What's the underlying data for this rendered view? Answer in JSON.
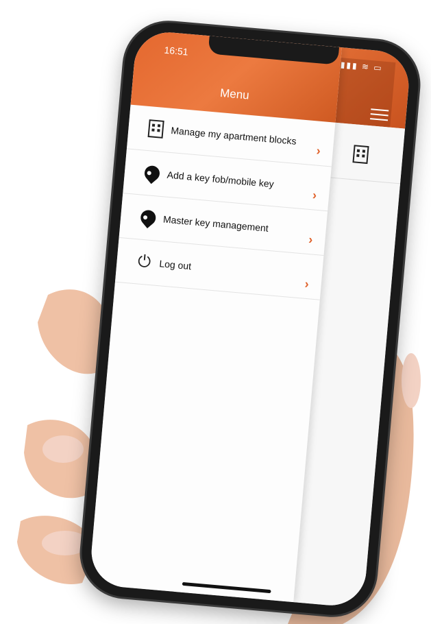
{
  "status": {
    "time": "16:51",
    "icons": "▮▮▮ ≋ ▭"
  },
  "drawer": {
    "title": "Menu"
  },
  "menu": {
    "items": [
      {
        "label": "Manage my apartment blocks",
        "icon": "building-icon"
      },
      {
        "label": "Add a key fob/mobile key",
        "icon": "key-fob-icon"
      },
      {
        "label": "Master key management",
        "icon": "key-fob-icon"
      },
      {
        "label": "Log out",
        "icon": "power-icon"
      }
    ]
  },
  "colors": {
    "accent": "#e0622b",
    "background": "#fdfdfd",
    "text": "#111111"
  }
}
